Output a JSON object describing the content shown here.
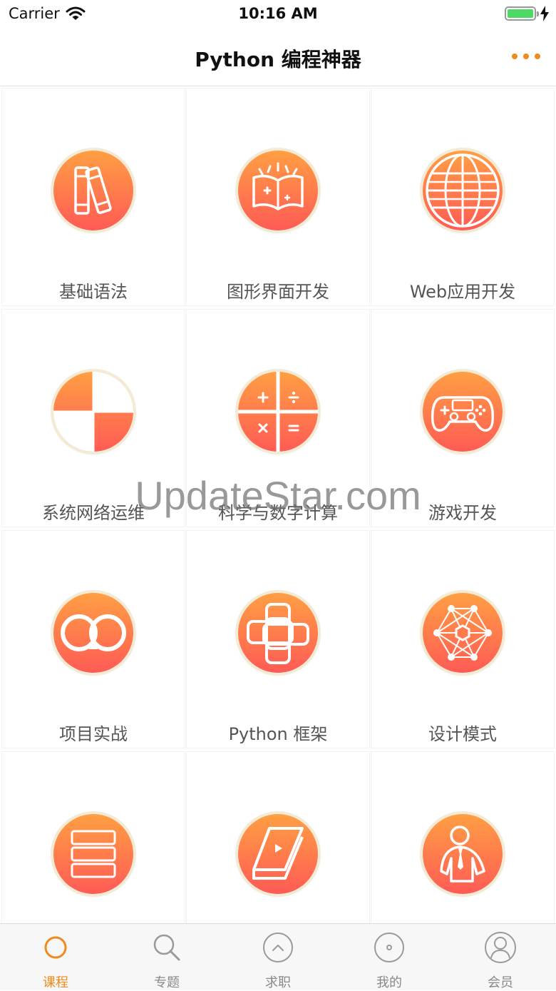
{
  "status_bar": {
    "carrier": "Carrier",
    "time": "10:16 AM",
    "battery_color": "#4cd964"
  },
  "nav": {
    "title": "Python 编程神器",
    "accent": "#f08a1c"
  },
  "grid": {
    "items": [
      {
        "label": "基础语法",
        "icon": "books-icon"
      },
      {
        "label": "图形界面开发",
        "icon": "open-book-icon"
      },
      {
        "label": "Web应用开发",
        "icon": "globe-icon"
      },
      {
        "label": "系统网络运维",
        "icon": "checker-quadrant-icon"
      },
      {
        "label": "科学与数字计算",
        "icon": "calculator-icon"
      },
      {
        "label": "游戏开发",
        "icon": "gamepad-icon"
      },
      {
        "label": "项目实战",
        "icon": "infinity-loop-icon"
      },
      {
        "label": "Python 框架",
        "icon": "python-cross-icon"
      },
      {
        "label": "设计模式",
        "icon": "network-nodes-icon"
      },
      {
        "label": "",
        "icon": "server-stack-icon"
      },
      {
        "label": "",
        "icon": "tablet-video-icon"
      },
      {
        "label": "",
        "icon": "person-tie-icon"
      }
    ],
    "icon_gradient": [
      "#ff9f43",
      "#ff5b55"
    ]
  },
  "watermark": "UpdateStar.com",
  "tabbar": {
    "tabs": [
      {
        "label": "课程",
        "icon": "circle-icon",
        "active": true
      },
      {
        "label": "专题",
        "icon": "search-icon",
        "active": false
      },
      {
        "label": "求职",
        "icon": "chevron-up-circle-icon",
        "active": false
      },
      {
        "label": "我的",
        "icon": "disc-icon",
        "active": false
      },
      {
        "label": "会员",
        "icon": "user-circle-icon",
        "active": false
      }
    ],
    "active_color": "#f08a1c",
    "inactive_color": "#888888"
  }
}
